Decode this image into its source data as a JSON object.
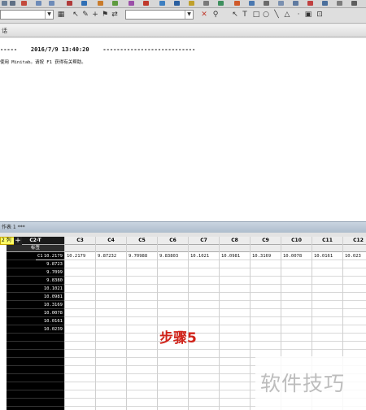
{
  "toolbar": {
    "combo_value": "",
    "combo2_value": "",
    "icons": [
      "chart-icon",
      "cursor-icon",
      "brush-icon",
      "crosshair-icon",
      "flag-icon",
      "swap-icon",
      "close-icon",
      "zoom-icon",
      "pointer-icon",
      "text-icon",
      "rectangle-icon",
      "ellipse-icon",
      "line-icon",
      "polygon-icon",
      "picture-icon",
      "marker-icon"
    ]
  },
  "session": {
    "title_fragment": "话",
    "header_line": "-----    2016/7/9 13:40:20    ---------------------------",
    "help_line": "使用 Minitab。请按 F1 获得有关帮助。"
  },
  "worksheet": {
    "tab_label": "作表 1 ***",
    "row_indicator": "2 列",
    "plus_label": "+",
    "columns": [
      {
        "header": "C2-T",
        "name": "标签",
        "values": [
          "10.2179",
          "9.8723",
          "9.7099",
          "9.8380",
          "10.1021",
          "10.0981",
          "10.3169",
          "10.0078",
          "10.0161",
          "10.0239"
        ],
        "dark": true
      },
      {
        "header": "C3",
        "name": "",
        "values": [
          "10.2179"
        ]
      },
      {
        "header": "C4",
        "name": "",
        "values": [
          "9.87232"
        ]
      },
      {
        "header": "C5",
        "name": "",
        "values": [
          "9.70988"
        ]
      },
      {
        "header": "C6",
        "name": "",
        "values": [
          "9.83803"
        ]
      },
      {
        "header": "C7",
        "name": "",
        "values": [
          "10.1021"
        ]
      },
      {
        "header": "C8",
        "name": "",
        "values": [
          "10.0981"
        ]
      },
      {
        "header": "C9",
        "name": "",
        "values": [
          "10.3169"
        ]
      },
      {
        "header": "C10",
        "name": "",
        "values": [
          "10.0078"
        ]
      },
      {
        "header": "C11",
        "name": "",
        "values": [
          "10.0161"
        ]
      },
      {
        "header": "C12",
        "name": "",
        "values": [
          "10.023"
        ]
      }
    ],
    "c2_first_label": "C1"
  },
  "overlay": {
    "step": "步骤5",
    "watermark": "软件技巧"
  },
  "colors": {
    "step_red": "#d0231a",
    "indicator_yellow": "#ffff66"
  }
}
